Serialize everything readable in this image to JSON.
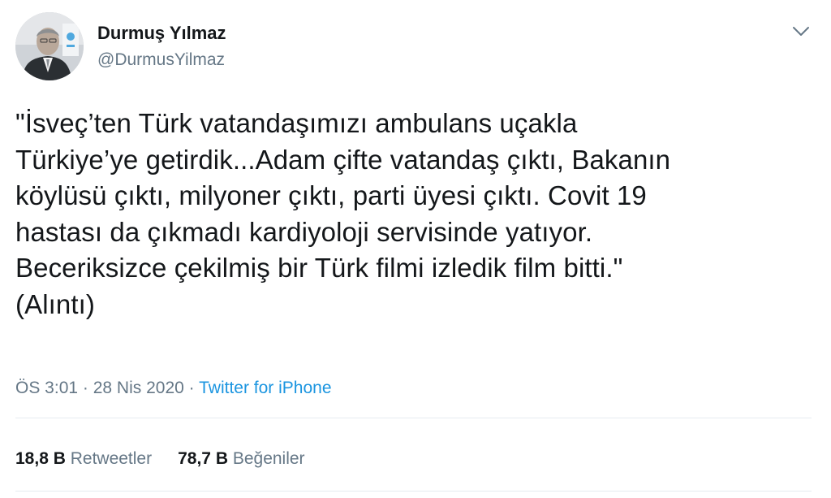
{
  "author": {
    "display_name": "Durmuş Yılmaz",
    "handle": "@DurmusYilmaz",
    "avatar_icon": "profile-photo"
  },
  "tweet": {
    "text": "\"İsveç’ten Türk vatandaşımızı ambulans uçakla\nTürkiye’ye getirdik...Adam çifte vatandaş çıktı, Bakanın\nköylüsü çıktı, milyoner çıktı, parti üyesi çıktı. Covit 19\nhastası da çıkmadı kardiyoloji servisinde yatıyor.\nBeceriksizce çekilmiş bir Türk filmi izledik film bitti.\"\n(Alıntı)",
    "time": "ÖS 3:01",
    "separator": " · ",
    "date": "28 Nis 2020",
    "source": "Twitter for iPhone"
  },
  "stats": {
    "retweets_count": "18,8 B",
    "retweets_label": "Retweetler",
    "likes_count": "78,7 B",
    "likes_label": "Beğeniler"
  },
  "colors": {
    "text": "#14171a",
    "secondary": "#657786",
    "link": "#1b95e0",
    "divider": "#e6ecf0"
  }
}
